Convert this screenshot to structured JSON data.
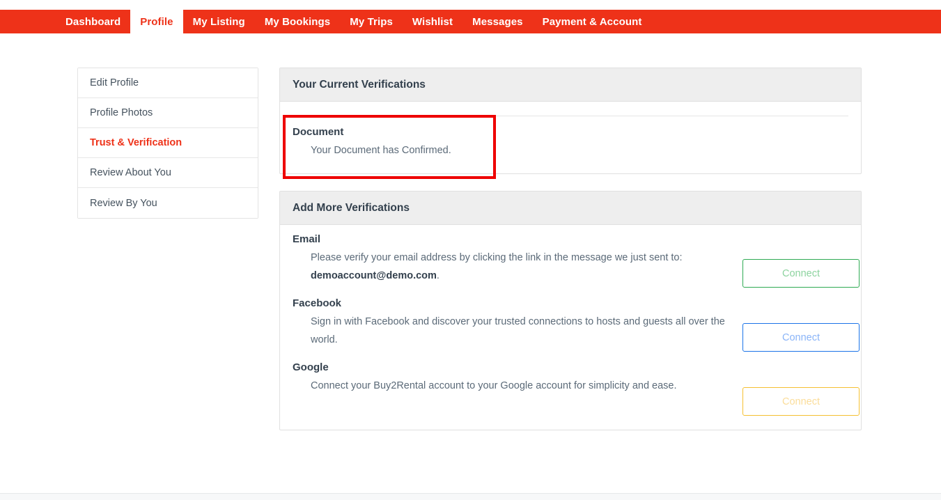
{
  "nav": {
    "items": [
      {
        "label": "Dashboard",
        "active": false
      },
      {
        "label": "Profile",
        "active": true
      },
      {
        "label": "My Listing",
        "active": false
      },
      {
        "label": "My Bookings",
        "active": false
      },
      {
        "label": "My Trips",
        "active": false
      },
      {
        "label": "Wishlist",
        "active": false
      },
      {
        "label": "Messages",
        "active": false
      },
      {
        "label": "Payment & Account",
        "active": false
      }
    ],
    "background_color": "#ee3219",
    "active_text_color": "#ee3219"
  },
  "sidebar": {
    "items": [
      {
        "label": "Edit Profile"
      },
      {
        "label": "Profile Photos"
      },
      {
        "label": "Trust & Verification"
      },
      {
        "label": "Review About You"
      },
      {
        "label": "Review By You"
      }
    ],
    "active_index": 2,
    "active_color": "#ee3219"
  },
  "current_verifications": {
    "header": "Your Current Verifications",
    "entries": [
      {
        "title": "Document",
        "description": "Your Document has Confirmed."
      }
    ]
  },
  "add_verifications": {
    "header": "Add More Verifications",
    "entries": [
      {
        "title": "Email",
        "description_prefix": "Please verify your email address by clicking the link in the message we just sent to: ",
        "description_bold": "demoaccount@demo.com",
        "description_suffix": ".",
        "button_label": "Connect",
        "button_color": "#2eaa52"
      },
      {
        "title": "Facebook",
        "description_prefix": "Sign in with Facebook and discover your trusted connections to hosts and guests all over the world.",
        "description_bold": "",
        "description_suffix": "",
        "button_label": "Connect",
        "button_color": "#1a73e8"
      },
      {
        "title": "Google",
        "description_prefix": "Connect your Buy2Rental account to your Google account for simplicity and ease.",
        "description_bold": "",
        "description_suffix": "",
        "button_label": "Connect",
        "button_color": "#f5c031"
      }
    ]
  },
  "annotation": {
    "color": "#ee0000",
    "target": "Document"
  }
}
